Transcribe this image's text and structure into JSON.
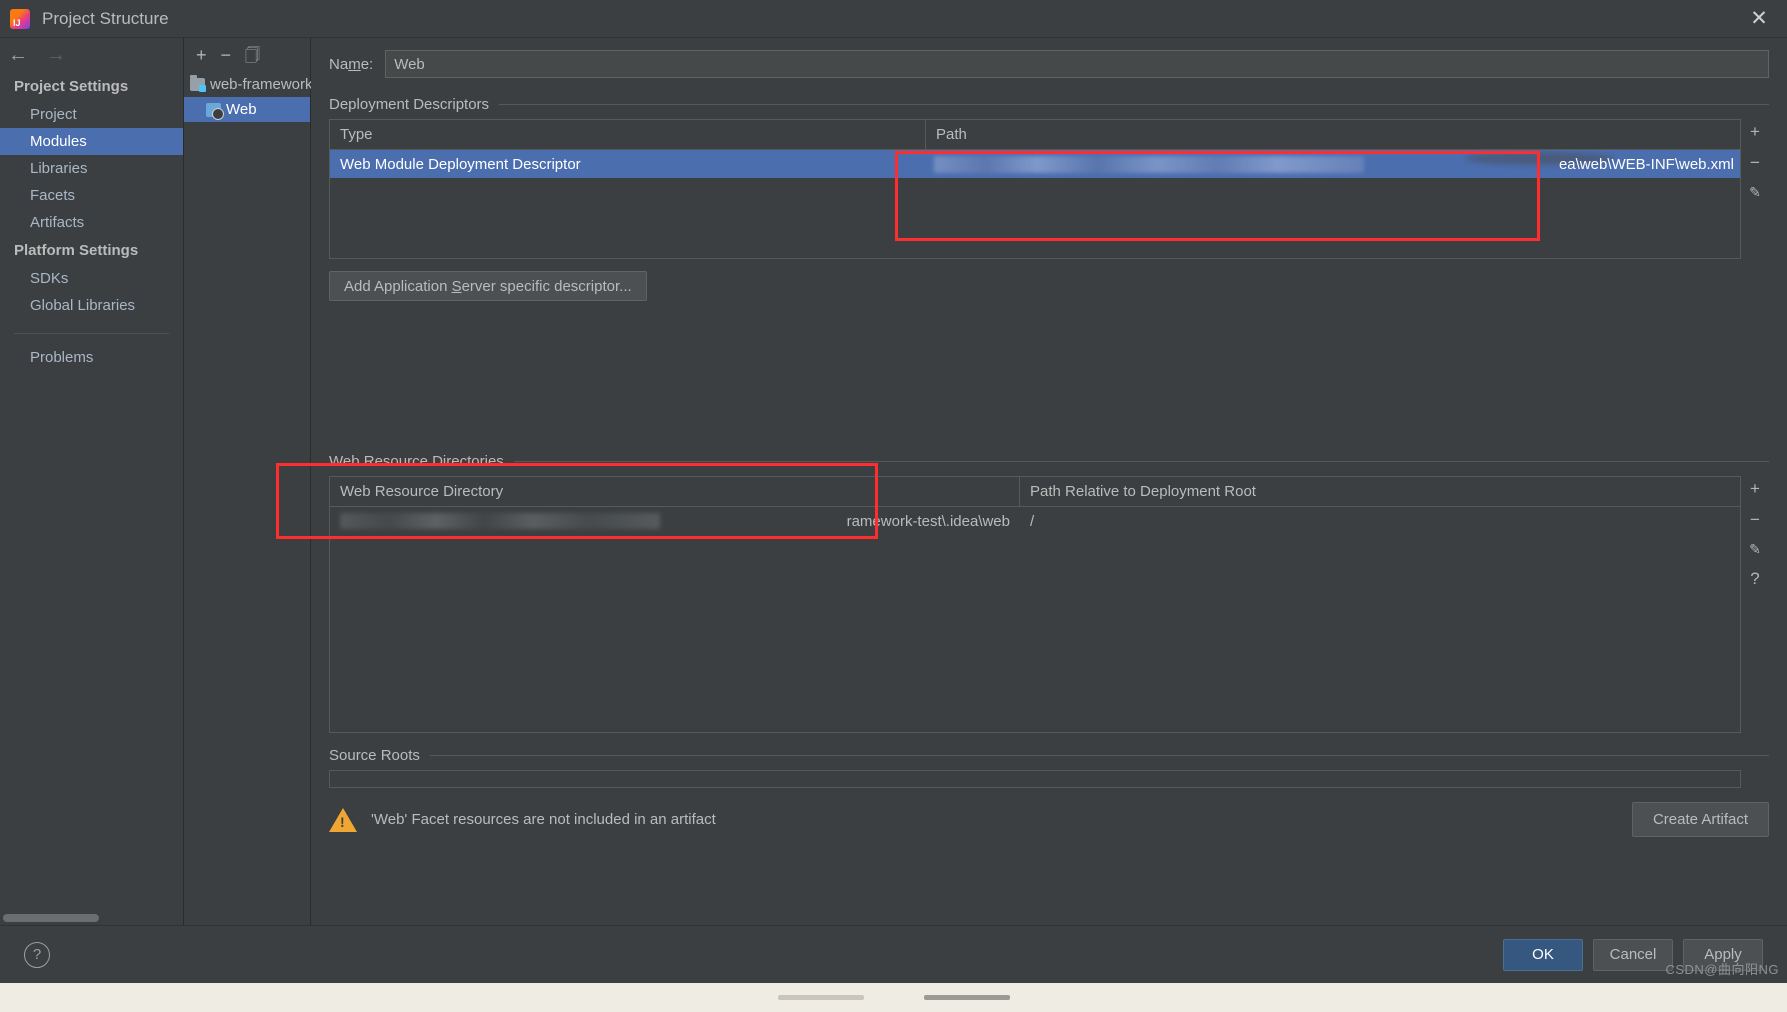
{
  "window": {
    "title": "Project Structure",
    "logo_icon": "intellij-idea-logo",
    "close_icon": "close-icon"
  },
  "nav": {
    "back_icon": "arrow-left-icon",
    "forward_icon": "arrow-right-icon"
  },
  "sidebar": {
    "groups": [
      {
        "label": "Project Settings",
        "items": [
          {
            "label": "Project",
            "selected": false
          },
          {
            "label": "Modules",
            "selected": true
          },
          {
            "label": "Libraries",
            "selected": false
          },
          {
            "label": "Facets",
            "selected": false
          },
          {
            "label": "Artifacts",
            "selected": false
          }
        ]
      },
      {
        "label": "Platform Settings",
        "items": [
          {
            "label": "SDKs",
            "selected": false
          },
          {
            "label": "Global Libraries",
            "selected": false
          }
        ]
      }
    ],
    "problems_label": "Problems"
  },
  "module_pane": {
    "toolbar": {
      "add_icon": "plus-icon",
      "remove_icon": "minus-icon",
      "copy_icon": "copy-icon"
    },
    "tree": [
      {
        "label": "web-framework-",
        "icon": "module-folder-icon",
        "selected": false
      },
      {
        "label": "Web",
        "icon": "web-facet-icon",
        "selected": true
      }
    ]
  },
  "name_field": {
    "label": "Name:",
    "label_mnemonic": "m",
    "value": "Web"
  },
  "deployment_descriptors": {
    "section_label": "Deployment Descriptors",
    "columns": [
      "Type",
      "Path"
    ],
    "rows": [
      {
        "type": "Web Module Deployment Descriptor",
        "path_visible_suffix": "ea\\web\\WEB-INF\\web.xml",
        "path_redacted": true,
        "selected": true
      }
    ],
    "add_descriptor_button": "Add Application Server specific descriptor...",
    "add_descriptor_mnemonic": "S",
    "tools": {
      "add_icon": "plus-icon",
      "remove_icon": "minus-icon",
      "edit_icon": "pencil-icon"
    }
  },
  "web_resource_directories": {
    "section_label": "Web Resource Directories",
    "columns": [
      "Web Resource Directory",
      "Path Relative to Deployment Root"
    ],
    "rows": [
      {
        "directory_visible_suffix": "ramework-test\\.idea\\web",
        "directory_redacted": true,
        "relative_path": "/"
      }
    ],
    "tools": {
      "add_icon": "plus-icon",
      "remove_icon": "minus-icon",
      "edit_icon": "pencil-icon",
      "help_icon": "question-mark-icon"
    }
  },
  "source_roots": {
    "section_label": "Source Roots"
  },
  "warning": {
    "icon": "warning-triangle-icon",
    "text": "'Web' Facet resources are not included in an artifact",
    "action_label": "Create Artifact"
  },
  "footer": {
    "help_icon": "question-mark-icon",
    "buttons": [
      {
        "label": "OK",
        "primary": true,
        "mnemonic": ""
      },
      {
        "label": "Cancel",
        "primary": false,
        "mnemonic": ""
      },
      {
        "label": "Apply",
        "primary": false,
        "mnemonic": "A"
      }
    ]
  },
  "annotations": {
    "color": "#ff2d2d",
    "boxes": [
      {
        "name": "descriptor-path-highlight"
      },
      {
        "name": "web-resource-directories-highlight"
      }
    ]
  },
  "watermark": "CSDN@曲向阳NG"
}
